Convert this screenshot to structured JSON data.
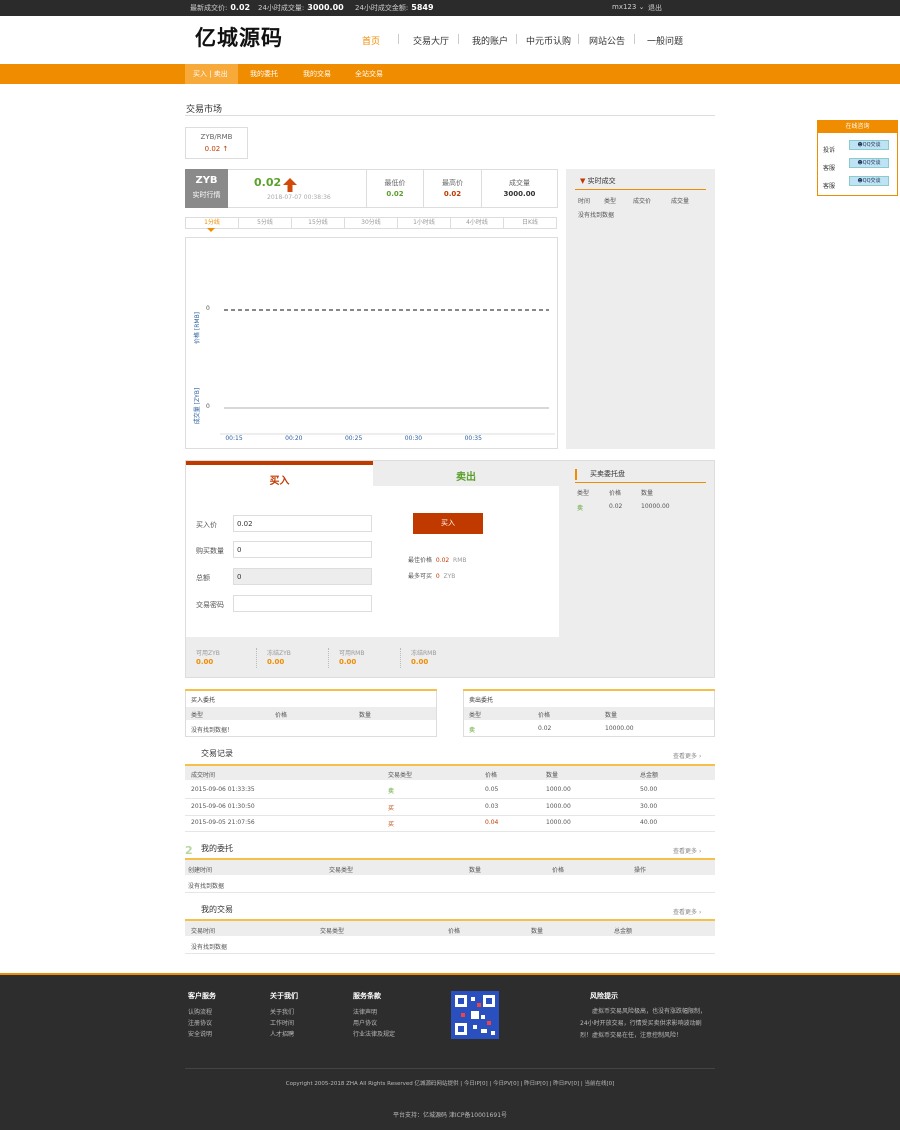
{
  "topbar": {
    "latest_price_label": "最新成交价:",
    "latest_price": "0.02",
    "volume_label": "24小时成交量:",
    "volume": "3000.00",
    "amount_label": "24小时成交金额:",
    "amount": "5849",
    "user": "mx123",
    "logout": "退出"
  },
  "header": {
    "logo_text": "亿城源码",
    "nav": [
      "首页",
      "交易大厅",
      "我的账户",
      "中元币认购",
      "网站公告",
      "一般问题"
    ]
  },
  "subnav": [
    "买入 | 卖出",
    "我的委托",
    "我的交易",
    "全站交易"
  ],
  "page_title": "交易市场",
  "market_card": {
    "pair": "ZYB/RMB",
    "price": "0.02 ↑"
  },
  "quote": {
    "coin": "ZYB",
    "coin_sub": "实时行情",
    "price": "0.02",
    "time": "2018-07-07 00:38:36",
    "low_label": "最低价",
    "low": "0.02",
    "high_label": "最高价",
    "high": "0.02",
    "vol_label": "成交量",
    "vol": "3000.00"
  },
  "chart_tabs": [
    "1分线",
    "5分线",
    "15分线",
    "30分线",
    "1小时线",
    "4小时线",
    "日K线"
  ],
  "chart_data": {
    "type": "line",
    "x": [
      "00:15",
      "00:20",
      "00:25",
      "00:30",
      "00:35"
    ],
    "series": [
      {
        "name": "价格 [RMB]",
        "values": [
          0,
          0,
          0,
          0,
          0
        ]
      },
      {
        "name": "成交量 [ZYB]",
        "values": [
          0,
          0,
          0,
          0,
          0
        ]
      }
    ],
    "ylabel_price": "价格 [RMB]",
    "ylabel_vol": "成交量 [ZYB]",
    "price_tick": "0",
    "vol_tick": "0"
  },
  "realtime": {
    "title": "实时成交",
    "cols": [
      "时间",
      "类型",
      "成交价",
      "成交量"
    ],
    "empty": "没有找到数据"
  },
  "trade": {
    "buy_tab": "买入",
    "sell_tab": "卖出",
    "price_label": "买入价",
    "price_value": "0.02",
    "qty_label": "购买数量",
    "qty_value": "0",
    "total_label": "总额",
    "total_value": "0",
    "pwd_label": "交易密码",
    "buy_button": "买入",
    "best_price_label": "最佳价格",
    "best_price": "0.02",
    "best_unit": "RMB",
    "max_label": "最多可买",
    "max_value": "0",
    "max_unit": "ZYB"
  },
  "balances": [
    {
      "label": "可用ZYB",
      "value": "0.00"
    },
    {
      "label": "冻结ZYB",
      "value": "0.00"
    },
    {
      "label": "可用RMB",
      "value": "0.00"
    },
    {
      "label": "冻结RMB",
      "value": "0.00"
    }
  ],
  "orderbook": {
    "title": "买卖委托盘",
    "cols": [
      "类型",
      "价格",
      "数量"
    ],
    "rows": [
      {
        "type": "卖",
        "price": "0.02",
        "qty": "10000.00"
      }
    ]
  },
  "buy_orders": {
    "title": "买入委托",
    "cols": [
      "类型",
      "价格",
      "数量"
    ],
    "empty": "没有找到数据！"
  },
  "sell_orders": {
    "title": "卖出委托",
    "cols": [
      "类型",
      "价格",
      "数量"
    ],
    "rows": [
      {
        "type": "卖",
        "price": "0.02",
        "qty": "10000.00"
      }
    ]
  },
  "records": {
    "title": "交易记录",
    "more": "查看更多",
    "cols": [
      "成交时间",
      "交易类型",
      "价格",
      "数量",
      "总金额"
    ],
    "rows": [
      {
        "time": "2015-09-06 01:33:35",
        "type": "卖",
        "price": "0.05",
        "qty": "1000.00",
        "total": "50.00"
      },
      {
        "time": "2015-09-06 01:30:50",
        "type": "买",
        "price": "0.03",
        "qty": "1000.00",
        "total": "30.00"
      },
      {
        "time": "2015-09-05 21:07:56",
        "type": "买",
        "price": "0.04",
        "qty": "1000.00",
        "total": "40.00"
      }
    ]
  },
  "my_orders": {
    "title": "我的委托",
    "more": "查看更多",
    "cols": [
      "创建时间",
      "交易类型",
      "数量",
      "价格",
      "操作"
    ],
    "empty": "没有找到数据"
  },
  "my_trades": {
    "title": "我的交易",
    "more": "查看更多",
    "cols": [
      "交易时间",
      "交易类型",
      "价格",
      "数量",
      "总金额"
    ],
    "empty": "没有找到数据"
  },
  "online_service": {
    "title": "在线咨询",
    "rows": [
      {
        "label": "投诉",
        "btn": "QQ交谈"
      },
      {
        "label": "客服",
        "btn": "QQ交谈"
      },
      {
        "label": "客服",
        "btn": "QQ交谈"
      }
    ]
  },
  "footer": {
    "col1_title": "客户服务",
    "col1": [
      "认购流程",
      "注册协议",
      "安全说明"
    ],
    "col2_title": "关于我们",
    "col2": [
      "关于我们",
      "工作时间",
      "人才招聘"
    ],
    "col3_title": "服务条款",
    "col3": [
      "法律声明",
      "用户协议",
      "行业法律及规定"
    ],
    "risk_title": "风险提示",
    "risk_text": "虚拟币交易风险极高，也没有涨跌幅限制，24小时开放交易，行情受买卖供求影响波动剧烈！虚拟币交易在任，注意控制风险！",
    "copyright": "Copyright 2005-2018 ZHA All Rights Reserved 亿城源码网站提供 | 今日IP[0] | 今日PV[0] | 昨日IP[0] | 昨日PV[0] | 当前在线[0]",
    "icp": "平台支持：亿城源码 津ICP备10001691号"
  },
  "colors": {
    "accent": "#f08c00",
    "red": "#c03a00",
    "green": "#5aa02c"
  }
}
